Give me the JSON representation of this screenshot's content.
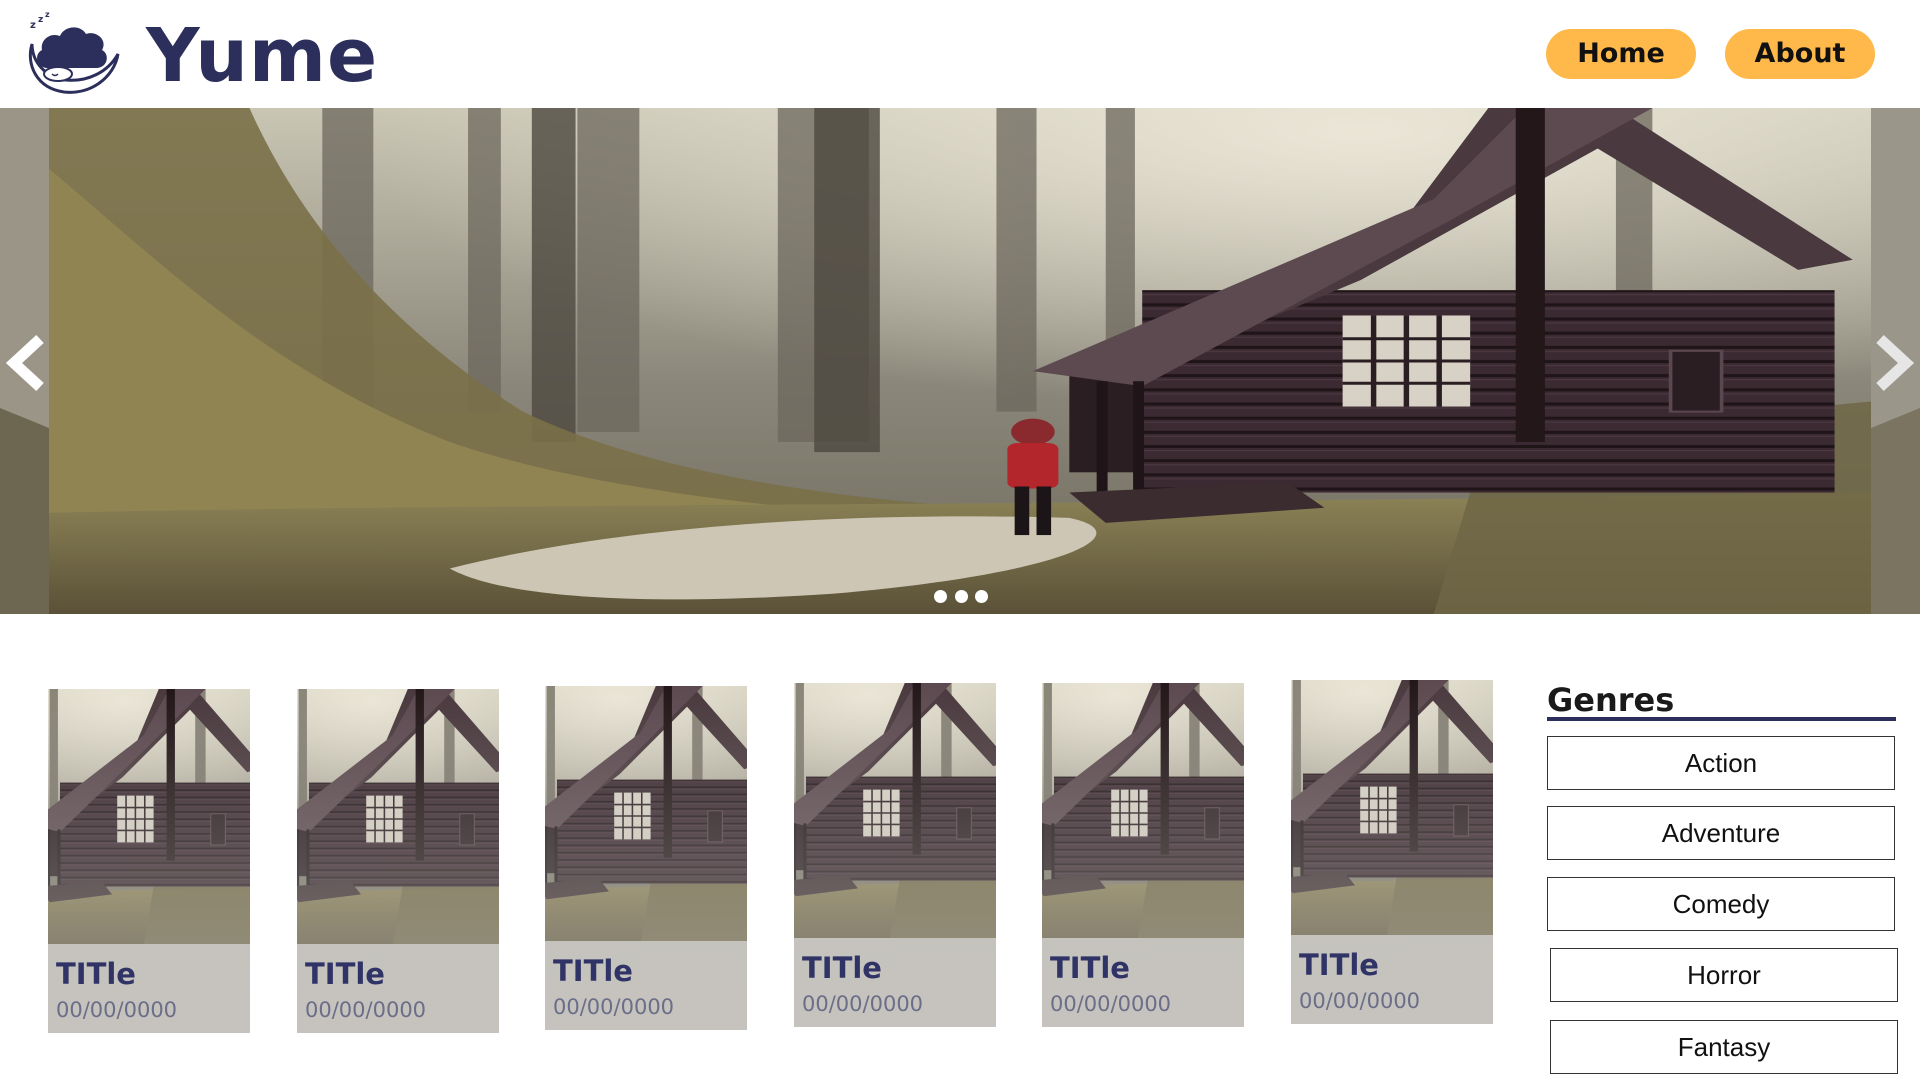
{
  "header": {
    "brand": "Yume",
    "logo_icon": "sleeping-sheep-cloud-moon-icon",
    "nav": [
      {
        "label": "Home"
      },
      {
        "label": "About"
      }
    ]
  },
  "hero": {
    "image": "forest-cabin-red-figure",
    "prev_icon": "chevron-left-icon",
    "next_icon": "chevron-right-icon",
    "slide_count": 3
  },
  "cards": [
    {
      "title": "TITle",
      "date": "00/00/0000"
    },
    {
      "title": "TITle",
      "date": "00/00/0000"
    },
    {
      "title": "TITle",
      "date": "00/00/0000"
    },
    {
      "title": "TITle",
      "date": "00/00/0000"
    },
    {
      "title": "TITle",
      "date": "00/00/0000"
    },
    {
      "title": "TITle",
      "date": "00/00/0000"
    }
  ],
  "genres": {
    "heading": "Genres",
    "items": [
      {
        "label": "Action"
      },
      {
        "label": "Adventure"
      },
      {
        "label": "Comedy"
      },
      {
        "label": "Horror"
      },
      {
        "label": "Fantasy"
      }
    ]
  },
  "colors": {
    "brand": "#2c2f5b",
    "nav_button": "#ffb94a",
    "card_title": "#2f3366",
    "card_date": "#6b6e88"
  }
}
